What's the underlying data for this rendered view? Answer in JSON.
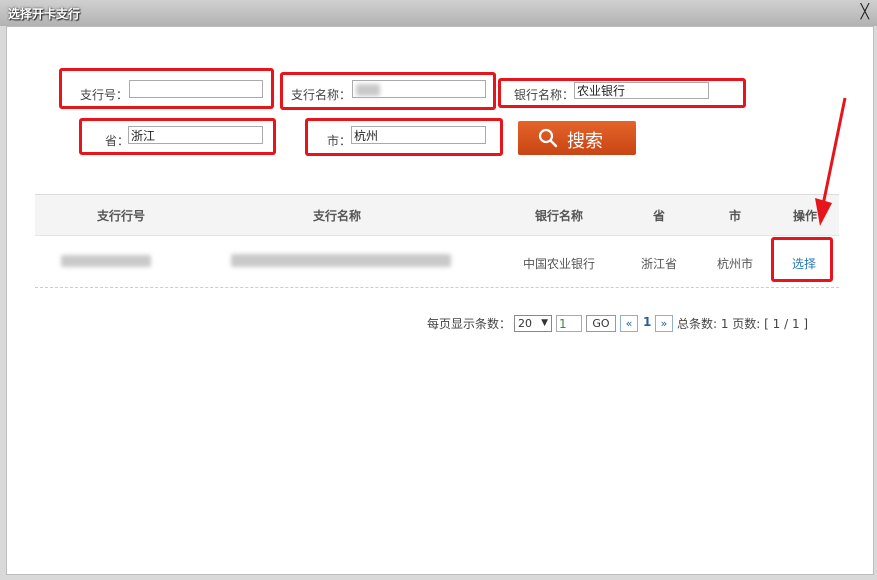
{
  "window": {
    "title": "选择开卡支行",
    "close_symbol": "╳"
  },
  "form": {
    "branch_no_label": "支行号：",
    "branch_no_value": "",
    "branch_name_label": "支行名称：",
    "branch_name_value": "",
    "bank_name_label": "银行名称：",
    "bank_name_value": "农业银行",
    "province_label": "省：",
    "province_value": "浙江",
    "city_label": "市：",
    "city_value": "杭州",
    "search_label": "搜索"
  },
  "table": {
    "headers": [
      "支行行号",
      "支行名称",
      "银行名称",
      "省",
      "市",
      "操作"
    ],
    "rows": [
      {
        "bank_name": "中国农业银行",
        "province": "浙江省",
        "city": "杭州市",
        "action": "选择"
      }
    ]
  },
  "pagination": {
    "per_page_label": "每页显示条数：",
    "per_page_value": "20",
    "select_arrow": "▼",
    "page_input": "1",
    "go_label": "GO",
    "prev_label": "«",
    "current_page": "1",
    "next_label": "»",
    "summary": "总条数: 1 页数: [ 1 / 1 ]"
  },
  "colors": {
    "highlight": "#e8141b",
    "link": "#2a7ab8",
    "button": "#d4531c"
  }
}
